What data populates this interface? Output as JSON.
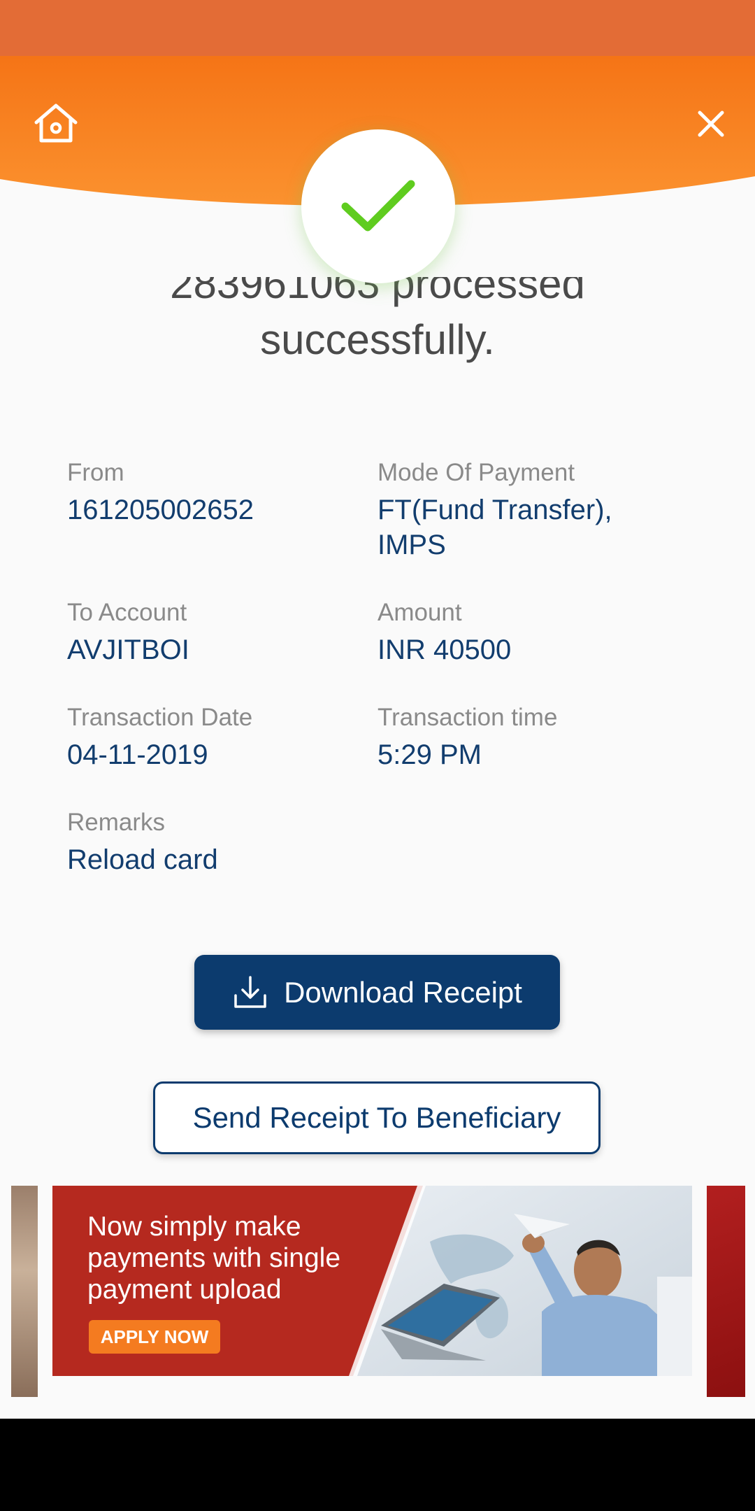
{
  "message": {
    "line1": "283961063 processed",
    "line2": "successfully."
  },
  "details": {
    "from_label": "From",
    "from_value": "161205002652",
    "mode_label": "Mode Of Payment",
    "mode_value_1": "FT(Fund Transfer),",
    "mode_value_2": "IMPS",
    "to_label": "To Account",
    "to_value": "AVJITBOI",
    "amount_label": "Amount",
    "amount_value": "INR 40500",
    "date_label": "Transaction Date",
    "date_value": "04-11-2019",
    "time_label": "Transaction time",
    "time_value": "5:29 PM",
    "remarks_label": "Remarks",
    "remarks_value": "Reload card"
  },
  "actions": {
    "download_label": "Download Receipt",
    "send_label": "Send Receipt To Beneficiary"
  },
  "banner": {
    "headline_1": "Now simply make",
    "headline_2": "payments with single",
    "headline_3": "payment upload",
    "cta": "APPLY NOW"
  },
  "icons": {
    "home": "home-icon",
    "close": "close-icon",
    "success": "check-icon",
    "download": "download-icon"
  },
  "colors": {
    "header_orange": "#f7841f",
    "status_bar": "#e36c36",
    "primary_navy": "#0c3b6e",
    "success_green": "#5fcc1f"
  }
}
